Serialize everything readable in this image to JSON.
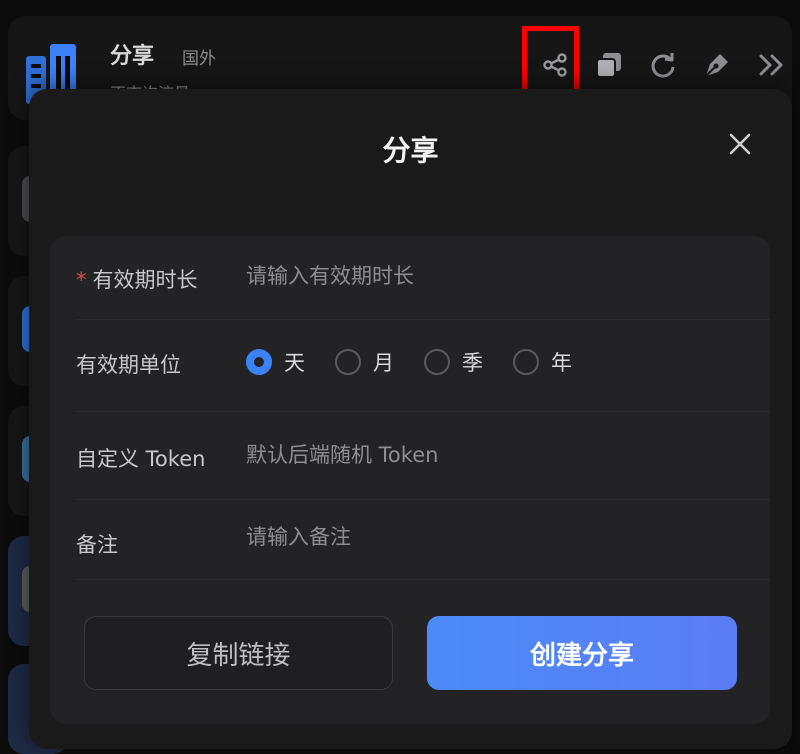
{
  "background": {
    "card_title": "分享",
    "card_tag": "国外",
    "card_subtitle": "不查询流量",
    "toolbar_icons": [
      "share-icon",
      "copy-icon",
      "refresh-icon",
      "pen-icon",
      "double-chevron-right-icon"
    ]
  },
  "modal": {
    "title": "分享",
    "close_icon": "close-icon",
    "fields": {
      "duration": {
        "required_mark": "*",
        "label": "有效期时长",
        "placeholder": "请输入有效期时长",
        "value": ""
      },
      "unit": {
        "label": "有效期单位",
        "options": [
          "天",
          "月",
          "季",
          "年"
        ],
        "selected": "天"
      },
      "token": {
        "label": "自定义 Token",
        "placeholder": "默认后端随机 Token",
        "value": ""
      },
      "note": {
        "label": "备注",
        "placeholder": "请输入备注",
        "value": ""
      }
    },
    "buttons": {
      "copy_link": "复制链接",
      "create_share": "创建分享"
    }
  },
  "colors": {
    "accent": "#3b82f6",
    "highlight": "#ff0000",
    "required": "#e5484d"
  }
}
